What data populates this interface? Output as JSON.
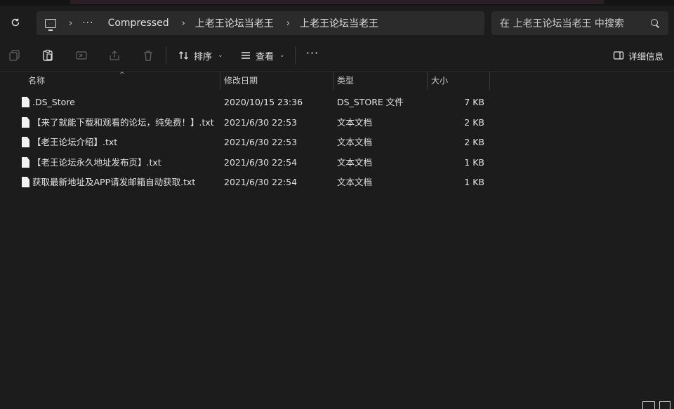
{
  "address_bar": {
    "dots": "···",
    "breadcrumbs": [
      "Compressed",
      "上老王论坛当老王",
      "上老王论坛当老王"
    ]
  },
  "search": {
    "placeholder": "在 上老王论坛当老王 中搜索"
  },
  "toolbar": {
    "sort_label": "排序",
    "view_label": "查看",
    "more_label": "···",
    "details_label": "详细信息"
  },
  "columns": {
    "name": "名称",
    "date": "修改日期",
    "type": "类型",
    "size": "大小"
  },
  "files": [
    {
      "name": ".DS_Store",
      "date": "2020/10/15 23:36",
      "type": "DS_STORE 文件",
      "size": "7 KB"
    },
    {
      "name": "【来了就能下载和观看的论坛，纯免费！】.txt",
      "date": "2021/6/30 22:53",
      "type": "文本文档",
      "size": "2 KB"
    },
    {
      "name": "【老王论坛介绍】.txt",
      "date": "2021/6/30 22:53",
      "type": "文本文档",
      "size": "2 KB"
    },
    {
      "name": "【老王论坛永久地址发布页】.txt",
      "date": "2021/6/30 22:54",
      "type": "文本文档",
      "size": "1 KB"
    },
    {
      "name": "获取最新地址及APP请发邮箱自动获取.txt",
      "date": "2021/6/30 22:54",
      "type": "文本文档",
      "size": "1 KB"
    }
  ],
  "icons": {
    "refresh": "refresh-icon",
    "pc": "computer-icon",
    "search": "search-icon",
    "copy": "copy-icon",
    "paste": "paste-icon",
    "rename": "rename-icon",
    "share": "share-icon",
    "delete": "delete-icon",
    "sort": "sort-icon",
    "view": "view-icon",
    "details": "details-pane-icon",
    "file": "file-icon"
  },
  "colors": {
    "background": "#1c1c1c",
    "panel": "#2b2b2b",
    "text": "#e2e2e2"
  }
}
